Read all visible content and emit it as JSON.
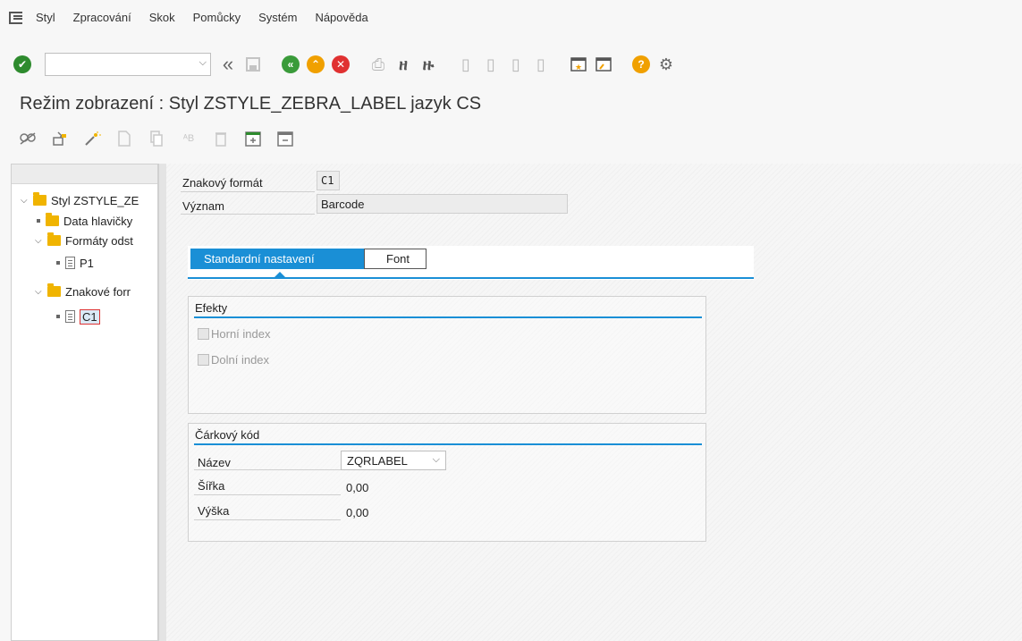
{
  "menubar": {
    "items": [
      "Styl",
      "Zpracování",
      "Skok",
      "Pomůcky",
      "Systém",
      "Nápověda"
    ]
  },
  "toolbar": {
    "command_value": "",
    "back_label": "«"
  },
  "title": "Režim zobrazení : Styl ZSTYLE_ZEBRA_LABEL jazyk CS",
  "tree": {
    "items": [
      {
        "label": "Styl ZSTYLE_ZE",
        "type": "folder",
        "level": 0,
        "expanded": true
      },
      {
        "label": "Data hlavičky",
        "type": "folder",
        "level": 1
      },
      {
        "label": "Formáty odst",
        "type": "folder",
        "level": 1,
        "expanded": true
      },
      {
        "label": "P1",
        "type": "doc",
        "level": 2
      },
      {
        "label": "Znakové forr",
        "type": "folder",
        "level": 1,
        "expanded": true
      },
      {
        "label": "C1",
        "type": "doc",
        "level": 2,
        "selected": true
      }
    ]
  },
  "header_fields": {
    "format_label": "Znakový formát",
    "format_value": "C1",
    "meaning_label": "Význam",
    "meaning_value": "Barcode"
  },
  "tabs": [
    {
      "label": "Standardní nastavení",
      "active": true
    },
    {
      "label": "Font",
      "active": false
    }
  ],
  "effects": {
    "title": "Efekty",
    "options": [
      "Horní index",
      "Dolní index"
    ]
  },
  "barcode": {
    "title": "Čárkový kód",
    "name_label": "Název",
    "name_value": "ZQRLABEL",
    "width_label": "Šířka",
    "width_value": "0,00",
    "height_label": "Výška",
    "height_value": "0,00"
  },
  "colors": {
    "accent": "#1a8fd6",
    "ok_green": "#2e8b2e",
    "nav_green": "#3a9b3a",
    "warn_orange": "#f0a000",
    "cancel_red": "#e03131",
    "folder": "#f0b400"
  }
}
